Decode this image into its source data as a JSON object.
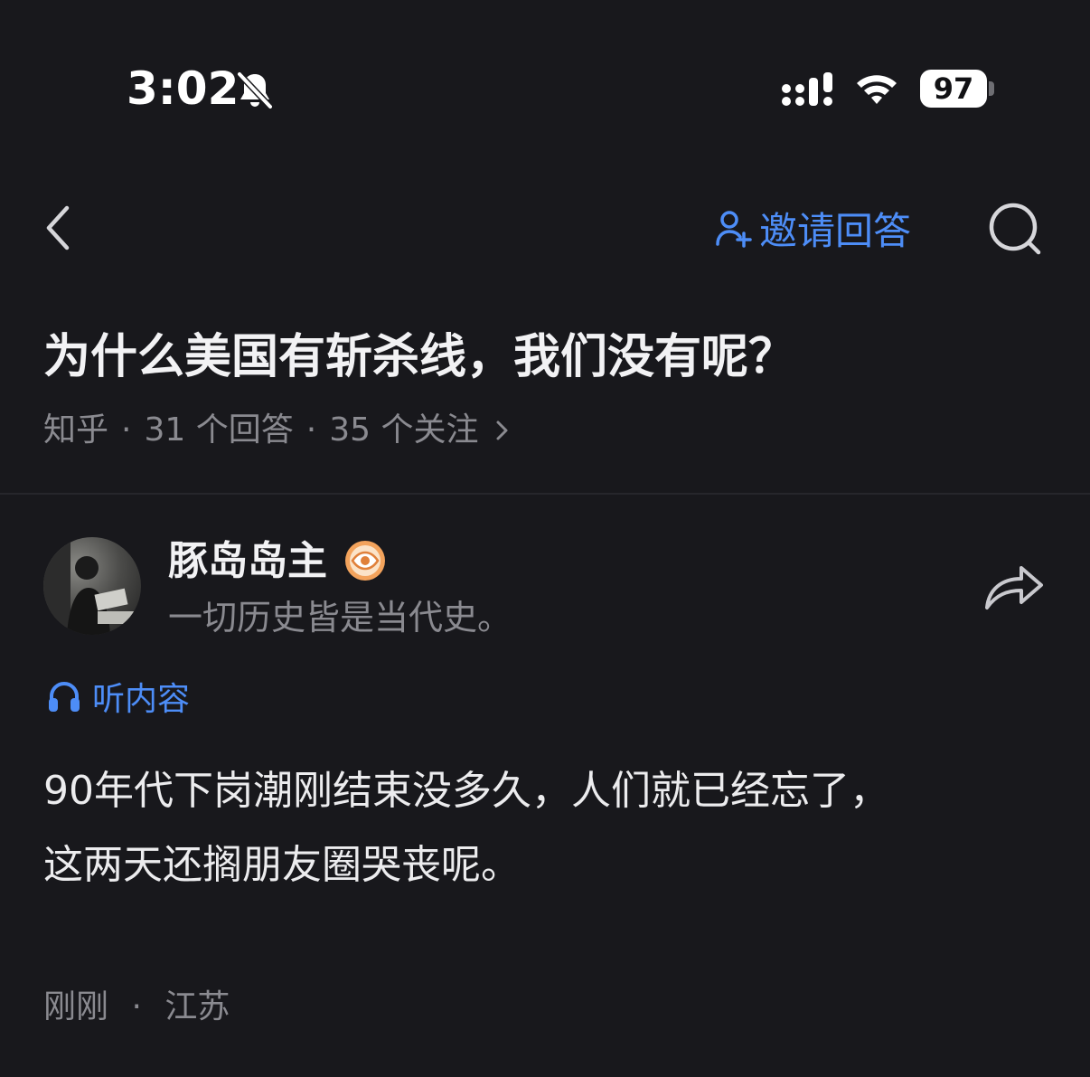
{
  "status_bar": {
    "time": "3:02",
    "battery": "97",
    "icons": [
      "bell-slash-icon",
      "signal-icon",
      "wifi-icon",
      "battery-icon"
    ]
  },
  "nav": {
    "back_icon": "chevron-left-icon",
    "invite_label": "邀请回答",
    "invite_icon": "user-plus-icon",
    "search_icon": "search-icon"
  },
  "question": {
    "title": "为什么美国有斩杀线，我们没有呢？",
    "source": "知乎",
    "answers": "31 个回答",
    "followers": "35 个关注",
    "separator": "·"
  },
  "answer": {
    "author": {
      "name": "豚岛岛主",
      "bio": "一切历史皆是当代史。",
      "badge_icon": "eye-badge-icon"
    },
    "share_icon": "share-icon",
    "listen_label": "听内容",
    "listen_icon": "headphones-icon",
    "content": [
      "90年代下岗潮刚结束没多久，人们就已经忘了，",
      "这两天还搁朋友圈哭丧呢。"
    ],
    "time": "刚刚",
    "location": "江苏"
  },
  "colors": {
    "background": "#18181c",
    "accent": "#4d8df7",
    "text_primary": "#f2f2f4",
    "text_secondary": "#8a8a90",
    "divider": "#26262b"
  }
}
